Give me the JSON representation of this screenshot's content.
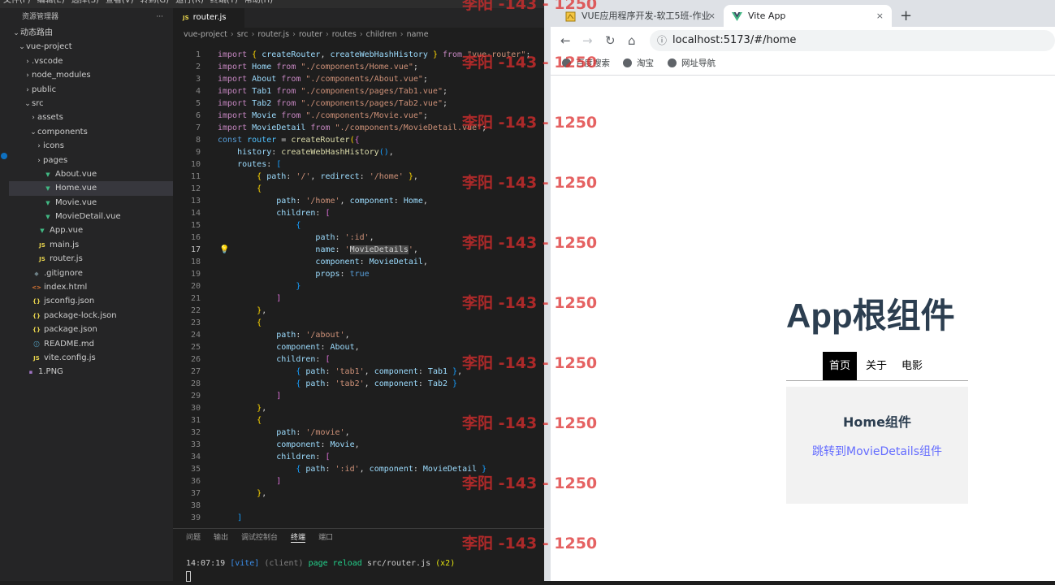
{
  "vscode": {
    "menu": [
      "文件(F)",
      "编辑(E)",
      "选择(S)",
      "查看(V)",
      "转到(G)",
      "运行(R)",
      "终端(T)",
      "帮助(H)"
    ],
    "explorer": {
      "title": "资源管理器",
      "more": "···",
      "items": [
        {
          "label": "动态路由",
          "depth": 0,
          "chevron": "⌄",
          "icon": ""
        },
        {
          "label": "vue-project",
          "depth": 1,
          "chevron": "⌄",
          "icon": ""
        },
        {
          "label": ".vscode",
          "depth": 2,
          "chevron": "›",
          "icon": ""
        },
        {
          "label": "node_modules",
          "depth": 2,
          "chevron": "›",
          "icon": ""
        },
        {
          "label": "public",
          "depth": 2,
          "chevron": "›",
          "icon": ""
        },
        {
          "label": "src",
          "depth": 2,
          "chevron": "⌄",
          "icon": ""
        },
        {
          "label": "assets",
          "depth": 3,
          "chevron": "›",
          "icon": ""
        },
        {
          "label": "components",
          "depth": 3,
          "chevron": "⌄",
          "icon": ""
        },
        {
          "label": "icons",
          "depth": 4,
          "chevron": "›",
          "icon": ""
        },
        {
          "label": "pages",
          "depth": 4,
          "chevron": "›",
          "icon": ""
        },
        {
          "label": "About.vue",
          "depth": 4,
          "chevron": "",
          "icon": "vue"
        },
        {
          "label": "Home.vue",
          "depth": 4,
          "chevron": "",
          "icon": "vue",
          "selected": true
        },
        {
          "label": "Movie.vue",
          "depth": 4,
          "chevron": "",
          "icon": "vue"
        },
        {
          "label": "MovieDetail.vue",
          "depth": 4,
          "chevron": "",
          "icon": "vue"
        },
        {
          "label": "App.vue",
          "depth": 3,
          "chevron": "",
          "icon": "vue"
        },
        {
          "label": "main.js",
          "depth": 3,
          "chevron": "",
          "icon": "js"
        },
        {
          "label": "router.js",
          "depth": 3,
          "chevron": "",
          "icon": "js"
        },
        {
          "label": ".gitignore",
          "depth": 2,
          "chevron": "",
          "icon": "git"
        },
        {
          "label": "index.html",
          "depth": 2,
          "chevron": "",
          "icon": "html"
        },
        {
          "label": "jsconfig.json",
          "depth": 2,
          "chevron": "",
          "icon": "json"
        },
        {
          "label": "package-lock.json",
          "depth": 2,
          "chevron": "",
          "icon": "json"
        },
        {
          "label": "package.json",
          "depth": 2,
          "chevron": "",
          "icon": "json"
        },
        {
          "label": "README.md",
          "depth": 2,
          "chevron": "",
          "icon": "info"
        },
        {
          "label": "vite.config.js",
          "depth": 2,
          "chevron": "",
          "icon": "js"
        },
        {
          "label": "1.PNG",
          "depth": 1,
          "chevron": "",
          "icon": "img"
        }
      ]
    },
    "tab": {
      "label": "router.js",
      "prefix": "JS"
    },
    "breadcrumb": [
      "vue-project",
      "src",
      "router.js",
      "router",
      "routes",
      "children",
      "name"
    ],
    "code": [
      [
        [
          "kw",
          "import "
        ],
        [
          "b1",
          "{ "
        ],
        [
          "id",
          "createRouter"
        ],
        [
          "p",
          ", "
        ],
        [
          "id",
          "createWebHashHistory "
        ],
        [
          "b1",
          "}"
        ],
        [
          "kw",
          " from "
        ],
        [
          "str",
          "\"vue-router\""
        ],
        [
          "p",
          ";"
        ]
      ],
      [
        [
          "kw",
          "import "
        ],
        [
          "id",
          "Home"
        ],
        [
          "kw",
          " from "
        ],
        [
          "str",
          "\"./components/Home.vue\""
        ],
        [
          "p",
          ";"
        ]
      ],
      [
        [
          "kw",
          "import "
        ],
        [
          "id",
          "About"
        ],
        [
          "kw",
          " from "
        ],
        [
          "str",
          "\"./components/About.vue\""
        ],
        [
          "p",
          ";"
        ]
      ],
      [
        [
          "kw",
          "import "
        ],
        [
          "id",
          "Tab1"
        ],
        [
          "kw",
          " from "
        ],
        [
          "str",
          "\"./components/pages/Tab1.vue\""
        ],
        [
          "p",
          ";"
        ]
      ],
      [
        [
          "kw",
          "import "
        ],
        [
          "id",
          "Tab2"
        ],
        [
          "kw",
          " from "
        ],
        [
          "str",
          "\"./components/pages/Tab2.vue\""
        ],
        [
          "p",
          ";"
        ]
      ],
      [
        [
          "kw",
          "import "
        ],
        [
          "id",
          "Movie"
        ],
        [
          "kw",
          " from "
        ],
        [
          "str",
          "\"./components/Movie.vue\""
        ],
        [
          "p",
          ";"
        ]
      ],
      [
        [
          "kw",
          "import "
        ],
        [
          "id",
          "MovieDetail"
        ],
        [
          "kw",
          " from "
        ],
        [
          "str",
          "\"./components/MovieDetail.vue\""
        ],
        [
          "p",
          ";"
        ]
      ],
      [
        [
          "bool",
          "const "
        ],
        [
          "cls",
          "router"
        ],
        [
          "p",
          " = "
        ],
        [
          "fn",
          "createRouter"
        ],
        [
          "b1",
          "("
        ],
        [
          "b2",
          "{"
        ]
      ],
      [
        [
          "p",
          "    "
        ],
        [
          "id",
          "history"
        ],
        [
          "p",
          ": "
        ],
        [
          "fn",
          "createWebHashHistory"
        ],
        [
          "b3",
          "()"
        ],
        [
          "p",
          ","
        ]
      ],
      [
        [
          "p",
          "    "
        ],
        [
          "id",
          "routes"
        ],
        [
          "p",
          ": "
        ],
        [
          "b3",
          "["
        ]
      ],
      [
        [
          "p",
          "        "
        ],
        [
          "b1",
          "{ "
        ],
        [
          "id",
          "path"
        ],
        [
          "p",
          ": "
        ],
        [
          "str",
          "'/'"
        ],
        [
          "p",
          ", "
        ],
        [
          "id",
          "redirect"
        ],
        [
          "p",
          ": "
        ],
        [
          "str",
          "'/home'"
        ],
        [
          "b1",
          " }"
        ],
        [
          "p",
          ","
        ]
      ],
      [
        [
          "p",
          "        "
        ],
        [
          "b1",
          "{"
        ]
      ],
      [
        [
          "p",
          "            "
        ],
        [
          "id",
          "path"
        ],
        [
          "p",
          ": "
        ],
        [
          "str",
          "'/home'"
        ],
        [
          "p",
          ", "
        ],
        [
          "id",
          "component"
        ],
        [
          "p",
          ": "
        ],
        [
          "id",
          "Home"
        ],
        [
          "p",
          ","
        ]
      ],
      [
        [
          "p",
          "            "
        ],
        [
          "id",
          "children"
        ],
        [
          "p",
          ": "
        ],
        [
          "b2",
          "["
        ]
      ],
      [
        [
          "p",
          "                "
        ],
        [
          "b3",
          "{"
        ]
      ],
      [
        [
          "p",
          "                    "
        ],
        [
          "id",
          "path"
        ],
        [
          "p",
          ": "
        ],
        [
          "str",
          "':id'"
        ],
        [
          "p",
          ","
        ]
      ],
      [
        [
          "p",
          "                    "
        ],
        [
          "id",
          "name"
        ],
        [
          "p",
          ": "
        ],
        [
          "str",
          "'"
        ],
        [
          "hl",
          "MovieDetails"
        ],
        [
          "str",
          "'"
        ],
        [
          "p",
          ","
        ]
      ],
      [
        [
          "p",
          "                    "
        ],
        [
          "id",
          "component"
        ],
        [
          "p",
          ": "
        ],
        [
          "id",
          "MovieDetail"
        ],
        [
          "p",
          ","
        ]
      ],
      [
        [
          "p",
          "                    "
        ],
        [
          "id",
          "props"
        ],
        [
          "p",
          ": "
        ],
        [
          "bool",
          "true"
        ]
      ],
      [
        [
          "p",
          "                "
        ],
        [
          "b3",
          "}"
        ]
      ],
      [
        [
          "p",
          "            "
        ],
        [
          "b2",
          "]"
        ]
      ],
      [
        [
          "p",
          "        "
        ],
        [
          "b1",
          "}"
        ],
        [
          "p",
          ","
        ]
      ],
      [
        [
          "p",
          "        "
        ],
        [
          "b1",
          "{"
        ]
      ],
      [
        [
          "p",
          "            "
        ],
        [
          "id",
          "path"
        ],
        [
          "p",
          ": "
        ],
        [
          "str",
          "'/about'"
        ],
        [
          "p",
          ","
        ]
      ],
      [
        [
          "p",
          "            "
        ],
        [
          "id",
          "component"
        ],
        [
          "p",
          ": "
        ],
        [
          "id",
          "About"
        ],
        [
          "p",
          ","
        ]
      ],
      [
        [
          "p",
          "            "
        ],
        [
          "id",
          "children"
        ],
        [
          "p",
          ": "
        ],
        [
          "b2",
          "["
        ]
      ],
      [
        [
          "p",
          "                "
        ],
        [
          "b3",
          "{ "
        ],
        [
          "id",
          "path"
        ],
        [
          "p",
          ": "
        ],
        [
          "str",
          "'tab1'"
        ],
        [
          "p",
          ", "
        ],
        [
          "id",
          "component"
        ],
        [
          "p",
          ": "
        ],
        [
          "id",
          "Tab1"
        ],
        [
          "b3",
          " }"
        ],
        [
          "p",
          ","
        ]
      ],
      [
        [
          "p",
          "                "
        ],
        [
          "b3",
          "{ "
        ],
        [
          "id",
          "path"
        ],
        [
          "p",
          ": "
        ],
        [
          "str",
          "'tab2'"
        ],
        [
          "p",
          ", "
        ],
        [
          "id",
          "component"
        ],
        [
          "p",
          ": "
        ],
        [
          "id",
          "Tab2"
        ],
        [
          "b3",
          " }"
        ]
      ],
      [
        [
          "p",
          "            "
        ],
        [
          "b2",
          "]"
        ]
      ],
      [
        [
          "p",
          "        "
        ],
        [
          "b1",
          "}"
        ],
        [
          "p",
          ","
        ]
      ],
      [
        [
          "p",
          "        "
        ],
        [
          "b1",
          "{"
        ]
      ],
      [
        [
          "p",
          "            "
        ],
        [
          "id",
          "path"
        ],
        [
          "p",
          ": "
        ],
        [
          "str",
          "'/movie'"
        ],
        [
          "p",
          ","
        ]
      ],
      [
        [
          "p",
          "            "
        ],
        [
          "id",
          "component"
        ],
        [
          "p",
          ": "
        ],
        [
          "id",
          "Movie"
        ],
        [
          "p",
          ","
        ]
      ],
      [
        [
          "p",
          "            "
        ],
        [
          "id",
          "children"
        ],
        [
          "p",
          ": "
        ],
        [
          "b2",
          "["
        ]
      ],
      [
        [
          "p",
          "                "
        ],
        [
          "b3",
          "{ "
        ],
        [
          "id",
          "path"
        ],
        [
          "p",
          ": "
        ],
        [
          "str",
          "':id'"
        ],
        [
          "p",
          ", "
        ],
        [
          "id",
          "component"
        ],
        [
          "p",
          ": "
        ],
        [
          "id",
          "MovieDetail"
        ],
        [
          "b3",
          " }"
        ]
      ],
      [
        [
          "p",
          "            "
        ],
        [
          "b2",
          "]"
        ]
      ],
      [
        [
          "p",
          "        "
        ],
        [
          "b1",
          "}"
        ],
        [
          "p",
          ","
        ]
      ],
      [
        [
          "p",
          ""
        ]
      ],
      [
        [
          "p",
          "    "
        ],
        [
          "b3",
          "]"
        ]
      ]
    ],
    "active_line": 17,
    "panel_tabs": [
      "问题",
      "输出",
      "调试控制台",
      "终端",
      "端口"
    ],
    "active_panel": "终端",
    "terminal": {
      "time": "14:07:19",
      "tag": "[vite]",
      "client": "(client)",
      "msg": "page reload",
      "file": "src/router.js",
      "count": "(x2)"
    }
  },
  "browser": {
    "tabs": [
      {
        "title": "VUE应用程序开发-软工5班-作业",
        "close": "×"
      },
      {
        "title": "Vite App",
        "close": "×"
      }
    ],
    "new_tab": "+",
    "nav": {
      "back": "←",
      "forward": "→",
      "reload": "↻",
      "home": "⌂"
    },
    "url": "localhost:5173/#/home",
    "bookmarks": [
      "百度搜索",
      "淘宝",
      "网址导航"
    ],
    "page": {
      "title": "App根组件",
      "nav": [
        "首页",
        "关于",
        "电影"
      ],
      "active_nav": "首页",
      "home_title": "Home组件",
      "home_link": "跳转到MovieDetails组件"
    }
  },
  "watermark": "李阳 -143 - 1250",
  "colors": {
    "vue": "#41b883",
    "js": "#e8d44d",
    "accent": "#646cff",
    "watermark": "#dc2d2d"
  }
}
